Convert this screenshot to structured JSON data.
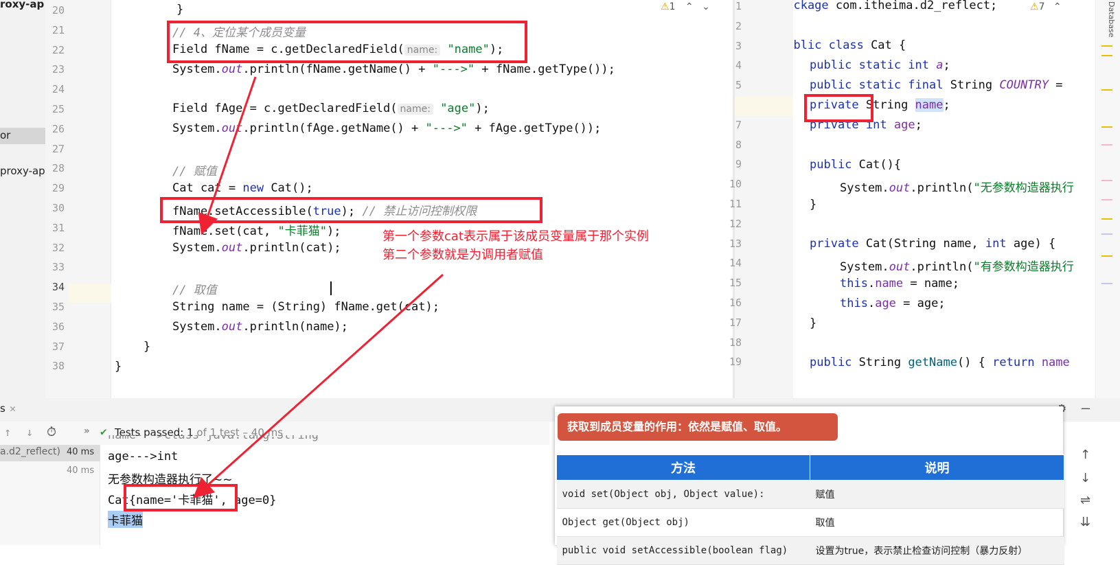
{
  "project": {
    "item1": "roxy-ap",
    "item2": "or",
    "item3": "proxy-ap"
  },
  "left_editor": {
    "warn_count": "1",
    "line_numbers": [
      "20",
      "21",
      "22",
      "23",
      "24",
      "25",
      "26",
      "27",
      "28",
      "29",
      "30",
      "31",
      "32",
      "33",
      "34",
      "35",
      "36",
      "37",
      "38"
    ],
    "lines": {
      "l20": "}",
      "l21": "// 4、定位某个成员变量",
      "l22a": "Field fName = c.getDeclaredField(",
      "l22hint": "name:",
      "l22str": "\"name\"",
      "l22b": ");",
      "l23a": "System.",
      "l23b": "out",
      "l23c": ".println(fName.getName() + ",
      "l23str": "\"--->\"",
      "l23d": " + fName.getType());",
      "l25a": "Field fAge = c.getDeclaredField(",
      "l25hint": "name:",
      "l25str": "\"age\"",
      "l25b": ");",
      "l26a": "System.",
      "l26b": "out",
      "l26c": ".println(fAge.getName() + ",
      "l26str": "\"--->\"",
      "l26d": " + fAge.getType());",
      "l28": "// 赋值",
      "l29a": "Cat cat = ",
      "l29kw": "new",
      "l29b": " Cat();",
      "l30a": "fName.setAccessible(",
      "l30kw": "true",
      "l30b": "); ",
      "l30cm": "// 禁止访问控制权限",
      "l31a": "fName.set(cat, ",
      "l31str": "\"卡菲猫\"",
      "l31b": ");",
      "l32a": "System.",
      "l32b": "out",
      "l32c": ".println(cat);",
      "l34": "// 取值",
      "l35": "String name = (String) fName.get(cat);",
      "l36a": "System.",
      "l36b": "out",
      "l36c": ".println(name);",
      "l37": "}",
      "l38": "}"
    },
    "annotation1": "第一个参数cat表示属于该成员变量属于那个实例",
    "annotation2": "第二个参数就是为调用者赋值"
  },
  "right_editor": {
    "warn_count": "7",
    "side_label": "Database",
    "line_numbers": [
      "1",
      "2",
      "3",
      "4",
      "5",
      "6",
      "7",
      "8",
      "9",
      "10",
      "11",
      "12",
      "13",
      "14",
      "15",
      "16",
      "17",
      "18",
      "19"
    ],
    "lines": {
      "r1a": "package",
      "r1b": " com.itheima.d2_reflect;",
      "r3a": "public class",
      "r3b": " Cat {",
      "r4a": "public static int",
      "r4b": "a",
      "r4c": ";",
      "r5a": "public static final",
      "r5b": " String ",
      "r5c": "COUNTRY",
      "r5d": " =",
      "r6a": "private",
      "r6b": " String ",
      "r6c": "name",
      "r6d": ";",
      "r7a": "private int",
      "r7b": "age",
      "r7c": ";",
      "r9a": "public",
      "r9b": "Cat(){",
      "r10a": "System.",
      "r10b": "out",
      "r10c": ".println(",
      "r10d": "\"无参数构造器执行",
      "r11": "}",
      "r13a": "private",
      "r13b": "Cat(String name, ",
      "r13c": "int",
      "r13d": " age) {",
      "r14a": "System.",
      "r14b": "out",
      "r14c": ".println(",
      "r14d": "\"有参数构造器执行",
      "r15a": "this",
      "r15b": ".",
      "r15c": "name",
      "r15d": " = name;",
      "r16a": "this",
      "r16b": ".",
      "r16c": "age",
      "r16d": " = age;",
      "r17": "}",
      "r19a": "public",
      "r19b": " String ",
      "r19c": "getName",
      "r19d": "() { ",
      "r19e": "return",
      "r19f": " name"
    }
  },
  "run_panel": {
    "tab_label": "s",
    "status_prefix": "Tests passed:",
    "status_count": "1",
    "status_rest": "of 1 test – 40 ms",
    "tree_item1": "a.d2_reflect)",
    "tree_time1": "40 ms",
    "tree_time2": "40 ms",
    "output": {
      "o0": "name--->class java.lang.String",
      "o1": "age--->int",
      "o2": "无参数构造器执行了~~",
      "o3": "Cat{name='卡菲猫', age=0}",
      "o4": "卡菲猫"
    }
  },
  "popup": {
    "tip": "获取到成员变量的作用：依然是赋值、取值。",
    "headers": [
      "方法",
      "说明"
    ],
    "rows": [
      {
        "method": "void set(Object obj, Object value):",
        "desc": "赋值"
      },
      {
        "method": "Object get(Object obj)",
        "desc": "取值"
      },
      {
        "method": "public void  setAccessible(boolean flag)",
        "desc": "设置为true，表示禁止检查访问控制（暴力反射）"
      }
    ]
  },
  "colors": {
    "annotation_red": "#ee2233",
    "keyword": "#1a31b3",
    "string": "#0a7d2a",
    "field": "#7a2fa8",
    "table_header": "#1f6fd6",
    "tip_bg": "#d4553f"
  }
}
